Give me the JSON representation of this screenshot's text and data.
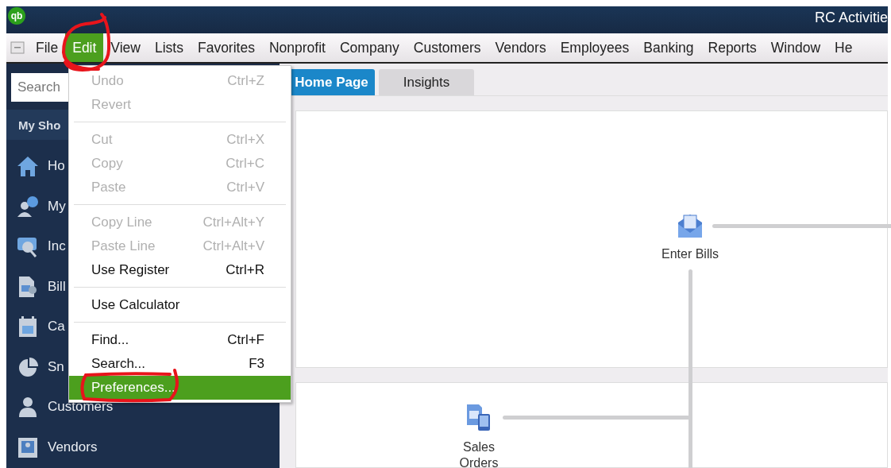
{
  "app_logo": "qb",
  "window": {
    "title": "RC Activitie"
  },
  "menu_bar": [
    {
      "label": "File",
      "selected": false
    },
    {
      "label": "Edit",
      "selected": true
    },
    {
      "label": "View",
      "selected": false
    },
    {
      "label": "Lists",
      "selected": false
    },
    {
      "label": "Favorites",
      "selected": false
    },
    {
      "label": "Nonprofit",
      "selected": false
    },
    {
      "label": "Company",
      "selected": false
    },
    {
      "label": "Customers",
      "selected": false
    },
    {
      "label": "Vendors",
      "selected": false
    },
    {
      "label": "Employees",
      "selected": false
    },
    {
      "label": "Banking",
      "selected": false
    },
    {
      "label": "Reports",
      "selected": false
    },
    {
      "label": "Window",
      "selected": false
    },
    {
      "label": "He",
      "selected": false
    }
  ],
  "search": {
    "placeholder": "Search"
  },
  "sidebar": {
    "header": "My Sho",
    "items": [
      {
        "label": "Ho"
      },
      {
        "label": "My"
      },
      {
        "label": "Inc"
      },
      {
        "label": "Bill"
      },
      {
        "label": "Ca"
      },
      {
        "label": "Sn"
      },
      {
        "label": "Customers"
      },
      {
        "label": "Vendors"
      }
    ]
  },
  "tabs": [
    {
      "label": "Home Page",
      "selected": true
    },
    {
      "label": "Insights",
      "selected": false
    }
  ],
  "edit_menu": [
    {
      "kind": "item",
      "label": "Undo",
      "shortcut": "Ctrl+Z",
      "disabled": true,
      "selected": false
    },
    {
      "kind": "item",
      "label": "Revert",
      "disabled": true,
      "selected": false
    },
    {
      "kind": "separator"
    },
    {
      "kind": "item",
      "label": "Cut",
      "shortcut": "Ctrl+X",
      "disabled": true,
      "selected": false
    },
    {
      "kind": "item",
      "label": "Copy",
      "shortcut": "Ctrl+C",
      "disabled": true,
      "selected": false
    },
    {
      "kind": "item",
      "label": "Paste",
      "shortcut": "Ctrl+V",
      "disabled": true,
      "selected": false
    },
    {
      "kind": "separator"
    },
    {
      "kind": "item",
      "label": "Copy Line",
      "shortcut": "Ctrl+Alt+Y",
      "disabled": true,
      "selected": false
    },
    {
      "kind": "item",
      "label": "Paste Line",
      "shortcut": "Ctrl+Alt+V",
      "disabled": true,
      "selected": false
    },
    {
      "kind": "item",
      "label": "Use Register",
      "shortcut": "Ctrl+R",
      "disabled": false,
      "selected": false
    },
    {
      "kind": "separator"
    },
    {
      "kind": "item",
      "label": "Use Calculator",
      "disabled": false,
      "selected": false
    },
    {
      "kind": "separator"
    },
    {
      "kind": "item",
      "label": "Find...",
      "shortcut": "Ctrl+F",
      "disabled": false,
      "selected": false
    },
    {
      "kind": "item",
      "label": "Search...",
      "shortcut": "F3",
      "disabled": false,
      "selected": false
    },
    {
      "kind": "item",
      "label": "Preferences...",
      "disabled": false,
      "selected": true
    }
  ],
  "home_page": {
    "nodes": [
      {
        "label": "Enter Bills"
      },
      {
        "label": "Sales Orders"
      }
    ]
  }
}
